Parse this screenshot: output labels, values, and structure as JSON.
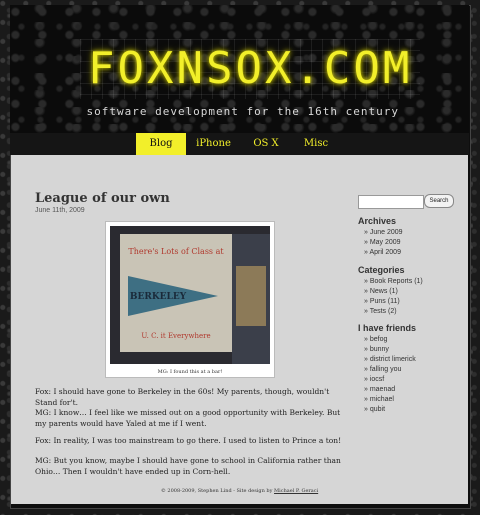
{
  "header": {
    "logo": "FOXNSOX.COM",
    "tagline": "software development for the 16th century"
  },
  "nav": {
    "items": [
      {
        "label": "Blog",
        "active": true
      },
      {
        "label": "iPhone",
        "active": false
      },
      {
        "label": "OS X",
        "active": false
      },
      {
        "label": "Misc",
        "active": false
      }
    ]
  },
  "post": {
    "title": "League of our own",
    "date": "June 11th, 2009",
    "photo": {
      "sign_line1": "There's Lots of Class at",
      "pennant": "BERKELEY",
      "sign_line3": "U. C. it Everywhere",
      "caption": "MG: I found this at a bar!"
    },
    "paragraphs": [
      "Fox:  I should have gone to Berkeley in the 60s!  My parents, though, wouldn't Stand for't.",
      "MG:  I know… I feel like we missed out on a good opportunity with Berkeley.  But my parents would have Yaled at me if I went.",
      "Fox:  In reality, I was too mainstream to go there.  I used to listen to Prince a ton!",
      "MG:  But you know, maybe I should have gone to school in California rather than Ohio… Then I wouldn't have ended up in Corn-hell."
    ]
  },
  "footer": {
    "text": "© 2008-2009, Stephen Lind - Site design by",
    "link": "Michael P. Geraci"
  },
  "sidebar": {
    "search_button": "Search",
    "search_placeholder": "",
    "archives_title": "Archives",
    "archives": [
      "» June 2009",
      "» May 2009",
      "» April 2009"
    ],
    "categories_title": "Categories",
    "categories": [
      "» Book Reports (1)",
      "» News (1)",
      "» Puns (11)",
      "» Tests (2)"
    ],
    "friends_title": "I have friends",
    "friends": [
      "» befog",
      "» bunny",
      "» district limerick",
      "» falling you",
      "» iocsf",
      "» maenad",
      "» michael",
      "» qubit"
    ]
  }
}
